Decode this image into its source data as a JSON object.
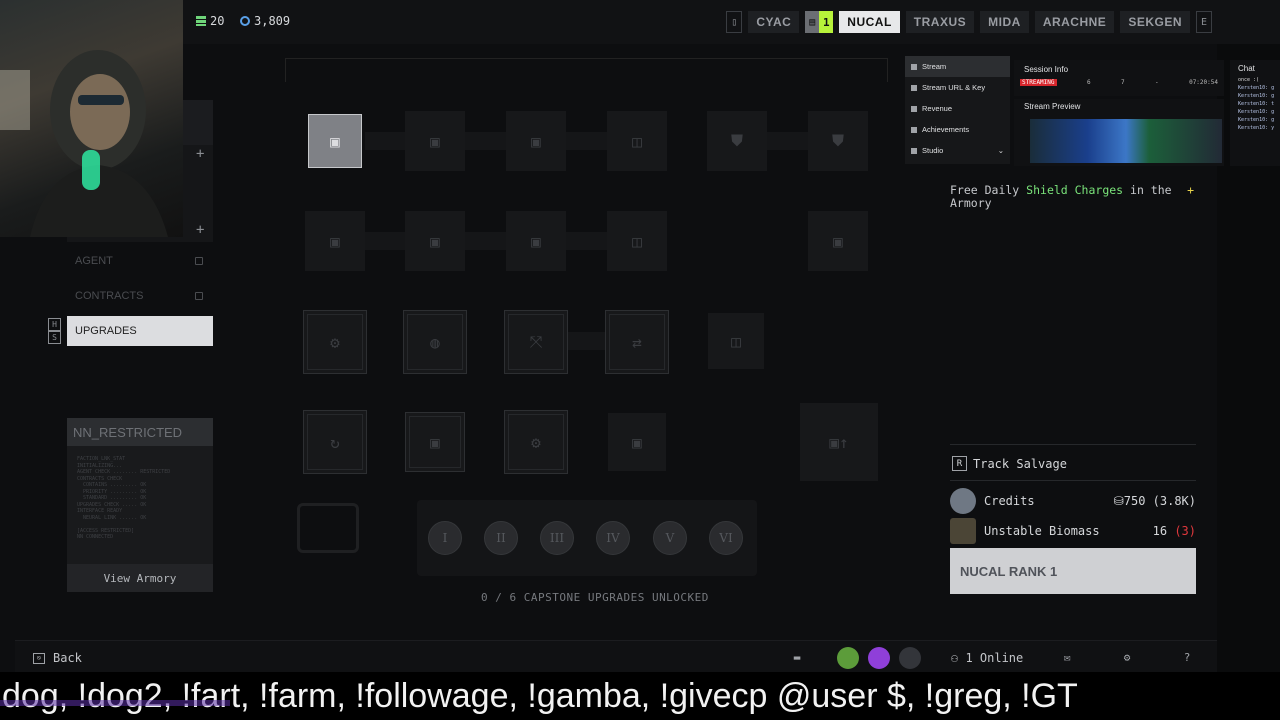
{
  "currency": {
    "a": "20",
    "b": "3,809"
  },
  "factions": [
    "CYAC",
    "NUCAL",
    "TRAXUS",
    "MIDA",
    "ARACHNE",
    "SEKGEN"
  ],
  "faction_active": "NUCAL",
  "faction_badge": "1",
  "sidebar": {
    "items": [
      {
        "label": "AGENT",
        "locked": true
      },
      {
        "label": "CONTRACTS",
        "locked": true
      },
      {
        "label": "UPGRADES",
        "locked": false
      }
    ],
    "hotkey_top": "H",
    "hotkey_bottom": "S"
  },
  "nn_panel": {
    "title": "NN_RESTRICTED",
    "body": "FACTION_LNK_STAT\nINITIALIZING...\nAGENT CHECK ........ RESTRICTED\nCONTRACTS CHECK\n  CONTAINS ......... OK\n  PRIORITY ......... OK\n  STANDARD ......... OK\nUPGRADES CHECK ..... OK\nINTERFACE READY\n  NEURAL LINK ...... OK\n\n[ACCESS RESTRICTED]\nNN CONNECTED",
    "button": "View Armory"
  },
  "tree": {
    "capstone_label": "0 / 6 CAPSTONE UPGRADES UNLOCKED",
    "capstones": [
      "I",
      "II",
      "III",
      "IV",
      "V",
      "VI"
    ]
  },
  "overlay_menu": [
    "Stream",
    "Stream URL & Key",
    "Revenue",
    "Achievements",
    "Studio"
  ],
  "session": {
    "title": "Session Info",
    "live": "STREAMING",
    "viewers": "6",
    "followers": "7",
    "dash": "-",
    "time": "07:20:54"
  },
  "preview": {
    "title": "Stream Preview"
  },
  "chat": {
    "title": "Chat",
    "top": "once :(",
    "messages": [
      "Kersten10: g",
      "Kersten10: g",
      "Kersten10: t",
      "Kersten10: g",
      "Kersten10: g",
      "Kersten10: y"
    ]
  },
  "perk": {
    "before": "Free Daily ",
    "highlight": "Shield Charges",
    "after": " in the Armory",
    "plus": "+"
  },
  "track": {
    "key": "R",
    "label": "Track Salvage"
  },
  "costs": [
    {
      "name": "Credits",
      "value": "750 (3.8K)",
      "extra": ""
    },
    {
      "name": "Unstable Biomass",
      "value": "16",
      "extra": "(3)"
    }
  ],
  "rank_button": "NUCAL RANK 1",
  "bottom": {
    "back": "Back",
    "back_key": "Esc",
    "online": "1 Online"
  },
  "ticker": "dog, !dog2, !fart, !farm, !followage, !gamba, !givecp @user $, !greg, !GT",
  "colors": {
    "highlight": "#7ae37a",
    "badge": "#b7f23a",
    "warning": "#e0383d",
    "accent_plus": "#e8d34b"
  }
}
